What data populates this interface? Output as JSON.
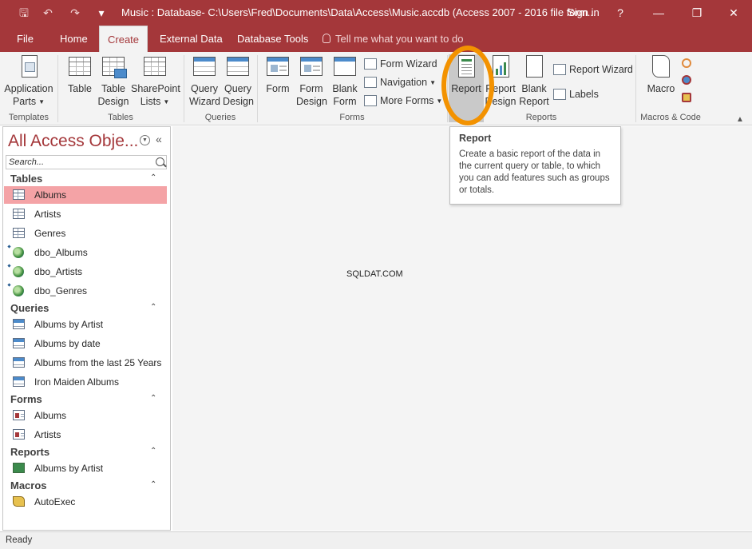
{
  "title_bar": {
    "title": "Music : Database- C:\\Users\\Fred\\Documents\\Data\\Access\\Music.accdb (Access 2007 - 2016 file form...",
    "sign_in": "Sign in",
    "help": "?",
    "qat": {
      "save": "🖫",
      "undo": "↶",
      "redo": "↷",
      "customize": "▾"
    },
    "window_buttons": {
      "minimize": "—",
      "restore": "❐",
      "close": "✕"
    }
  },
  "tabs": {
    "file": "File",
    "home": "Home",
    "create": "Create",
    "external_data": "External Data",
    "database_tools": "Database Tools",
    "tell_me": "Tell me what you want to do"
  },
  "ribbon": {
    "templates": {
      "application_parts_1": "Application",
      "application_parts_2": "Parts",
      "group": "Templates"
    },
    "tables": {
      "table": "Table",
      "table_design_1": "Table",
      "table_design_2": "Design",
      "sharepoint_1": "SharePoint",
      "sharepoint_2": "Lists",
      "group": "Tables"
    },
    "queries": {
      "wizard_1": "Query",
      "wizard_2": "Wizard",
      "design_1": "Query",
      "design_2": "Design",
      "group": "Queries"
    },
    "forms": {
      "form": "Form",
      "design_1": "Form",
      "design_2": "Design",
      "blank_1": "Blank",
      "blank_2": "Form",
      "wizard": "Form Wizard",
      "navigation": "Navigation",
      "more": "More Forms",
      "group": "Forms"
    },
    "reports": {
      "report": "Report",
      "design_1": "Report",
      "design_2": "Design",
      "blank_1": "Blank",
      "blank_2": "Report",
      "wizard": "Report Wizard",
      "labels": "Labels",
      "group": "Reports"
    },
    "macros": {
      "macro": "Macro",
      "group": "Macros & Code"
    }
  },
  "nav_pane": {
    "title": "All Access Obje...",
    "search_placeholder": "Search...",
    "sections": {
      "tables": "Tables",
      "queries": "Queries",
      "forms": "Forms",
      "reports": "Reports",
      "macros": "Macros"
    },
    "tables": [
      "Albums",
      "Artists",
      "Genres",
      "dbo_Albums",
      "dbo_Artists",
      "dbo_Genres"
    ],
    "queries": [
      "Albums by Artist",
      "Albums by date",
      "Albums from the last 25 Years",
      "Iron Maiden Albums"
    ],
    "forms": [
      "Albums",
      "Artists"
    ],
    "reports": [
      "Albums by Artist"
    ],
    "macros": [
      "AutoExec"
    ]
  },
  "tooltip": {
    "title": "Report",
    "body": "Create a basic report of the data in the current query or table, to which you can add features such as groups or totals."
  },
  "watermark": "SQLDAT.COM",
  "status": "Ready",
  "colors": {
    "accent": "#a4373a",
    "selection": "#f4a3a6",
    "highlight": "#f39200"
  }
}
